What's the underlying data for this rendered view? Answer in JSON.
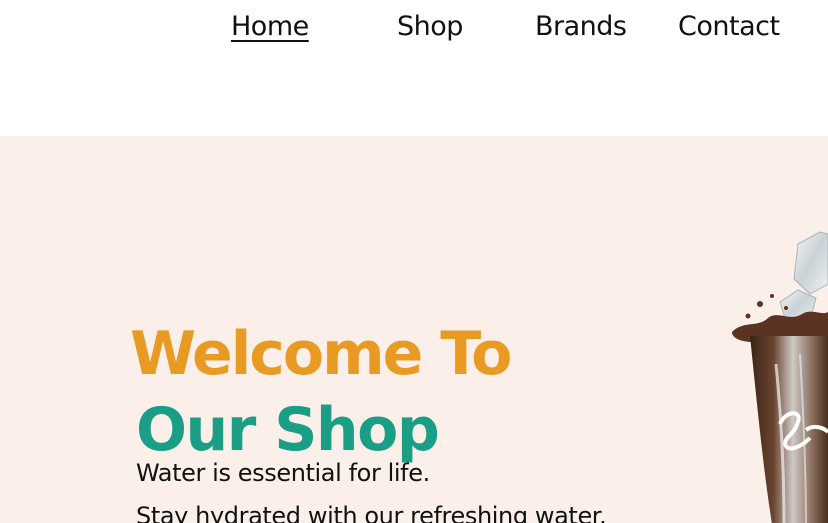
{
  "nav": {
    "items": [
      {
        "label": "Home",
        "active": true
      },
      {
        "label": "Shop",
        "active": false
      },
      {
        "label": "Brands",
        "active": false
      },
      {
        "label": "Contact",
        "active": false
      }
    ]
  },
  "hero": {
    "title_line1": "Welcome To",
    "title_line2": "Our Shop",
    "subtitle_line1": "Water is essential for life.",
    "subtitle_line2": "Stay hydrated with our refreshing water.",
    "image_icon": "cola-glass-image"
  },
  "colors": {
    "hero_background": "#fbf0e9",
    "title_orange": "#e89a22",
    "title_teal": "#1a9e85",
    "text": "#111111"
  }
}
